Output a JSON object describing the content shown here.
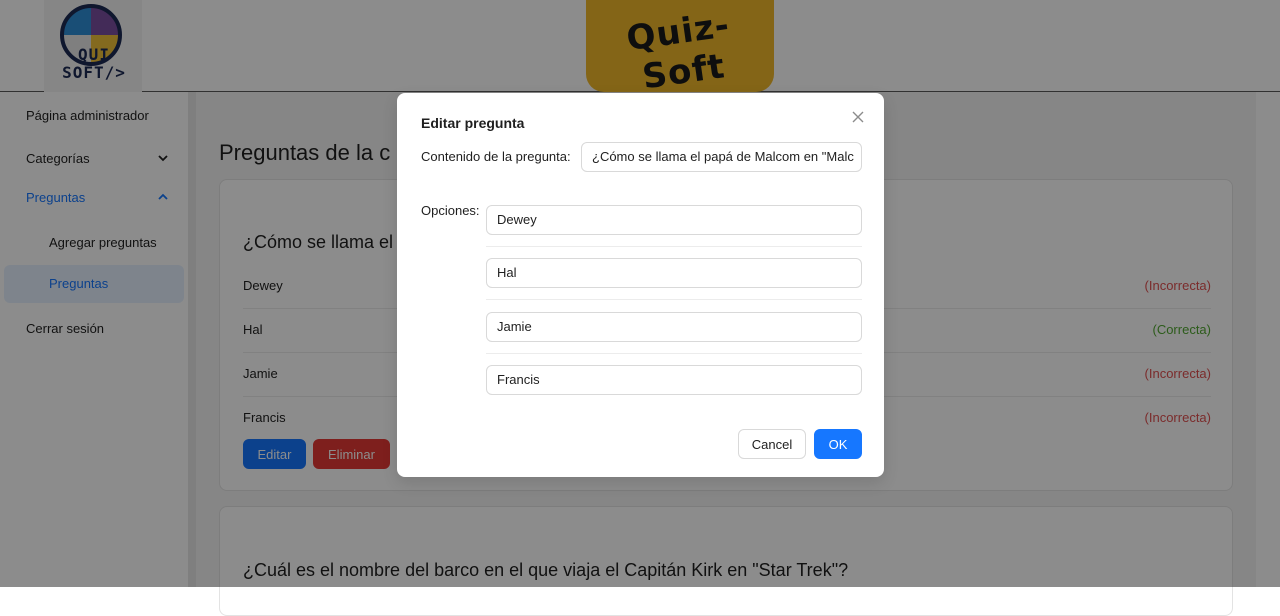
{
  "header": {
    "logo_text": "QUI\nSOFT/>",
    "brand": "Quiz-Soft",
    "colors": {
      "brand_bg": "#f0b92a",
      "logo_ring": "#1d2a55"
    }
  },
  "sidebar": {
    "items": [
      {
        "label": "Página administrador"
      },
      {
        "label": "Categorías",
        "icon": "chevron-down-icon"
      },
      {
        "label": "Preguntas",
        "icon": "chevron-up-icon"
      },
      {
        "label": "Agregar preguntas"
      },
      {
        "label": "Preguntas"
      },
      {
        "label": "Cerrar sesión"
      }
    ]
  },
  "main": {
    "page_title": "Preguntas de la c",
    "questions": [
      {
        "title": "¿Cómo se llama el",
        "options": [
          {
            "text": "Dewey",
            "status": "(Incorrecta)"
          },
          {
            "text": "Hal",
            "status": "(Correcta)"
          },
          {
            "text": "Jamie",
            "status": "(Incorrecta)"
          },
          {
            "text": "Francis",
            "status": "(Incorrecta)"
          }
        ],
        "edit_label": "Editar",
        "delete_label": "Eliminar"
      },
      {
        "title": "¿Cuál es el nombre del barco en el que viaja el Capitán Kirk en \"Star Trek\"?"
      }
    ]
  },
  "modal": {
    "title": "Editar pregunta",
    "content_label": "Contenido de la pregunta",
    "content_value": "¿Cómo se llama el papá de Malcom en \"Malc",
    "options_label": "Opciones",
    "options": [
      "Dewey",
      "Hal",
      "Jamie",
      "Francis"
    ],
    "cancel_label": "Cancel",
    "ok_label": "OK",
    "close_icon": "close-icon"
  },
  "colors": {
    "primary": "#1677ff",
    "danger": "#e53935",
    "correct": "#52a832",
    "incorrect": "#e05050"
  }
}
